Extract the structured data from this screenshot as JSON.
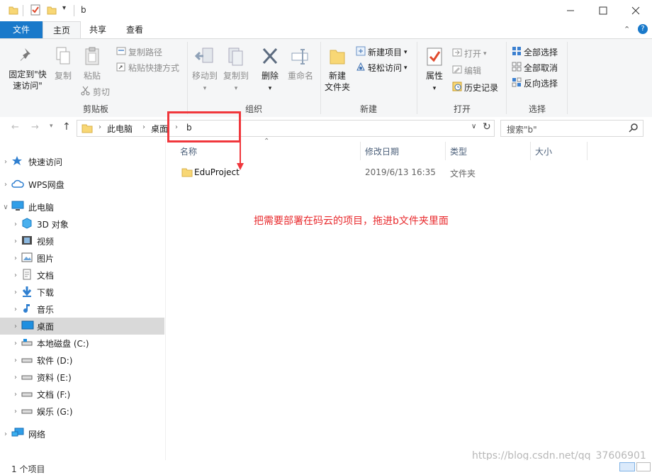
{
  "window": {
    "title": "b"
  },
  "tabs": [
    {
      "label": "文件"
    },
    {
      "label": "主页"
    },
    {
      "label": "共享"
    },
    {
      "label": "查看"
    }
  ],
  "ribbon": {
    "clipboard": {
      "pin_label_1": "固定到\"快",
      "pin_label_2": "速访问\"",
      "copy": "复制",
      "paste": "粘贴",
      "copy_path": "复制路径",
      "paste_shortcut": "粘贴快捷方式",
      "cut": "剪切",
      "group": "剪贴板"
    },
    "organize": {
      "move_to": "移动到",
      "copy_to": "复制到",
      "delete": "删除",
      "rename": "重命名",
      "group": "组织"
    },
    "new": {
      "new_folder_1": "新建",
      "new_folder_2": "文件夹",
      "new_item": "新建项目",
      "easy_access": "轻松访问",
      "group": "新建"
    },
    "open": {
      "properties": "属性",
      "open": "打开",
      "edit": "编辑",
      "history": "历史记录",
      "group": "打开"
    },
    "select": {
      "select_all": "全部选择",
      "select_none": "全部取消",
      "invert": "反向选择",
      "group": "选择"
    }
  },
  "address": {
    "crumbs": [
      "此电脑",
      "桌面",
      "b"
    ],
    "search_placeholder": "搜索\"b\""
  },
  "nav": {
    "quick_access": "快速访问",
    "wps": "WPS网盘",
    "this_pc": "此电脑",
    "children": [
      "3D 对象",
      "视频",
      "图片",
      "文档",
      "下载",
      "音乐",
      "桌面",
      "本地磁盘 (C:)",
      "软件 (D:)",
      "资料 (E:)",
      "文档 (F:)",
      "娱乐 (G:)"
    ],
    "network": "网络"
  },
  "columns": {
    "name": "名称",
    "modified": "修改日期",
    "type": "类型",
    "size": "大小"
  },
  "files": [
    {
      "name": "EduProject",
      "modified": "2019/6/13 16:35",
      "type": "文件夹",
      "size": ""
    }
  ],
  "annotation": "把需要部署在码云的项目，拖进b文件夹里面",
  "status": "1 个项目",
  "watermark": "https://blog.csdn.net/qq_37606901",
  "colors": {
    "accent": "#1979ca",
    "folder": "#f8d775",
    "annotation_red": "#f0373c"
  }
}
